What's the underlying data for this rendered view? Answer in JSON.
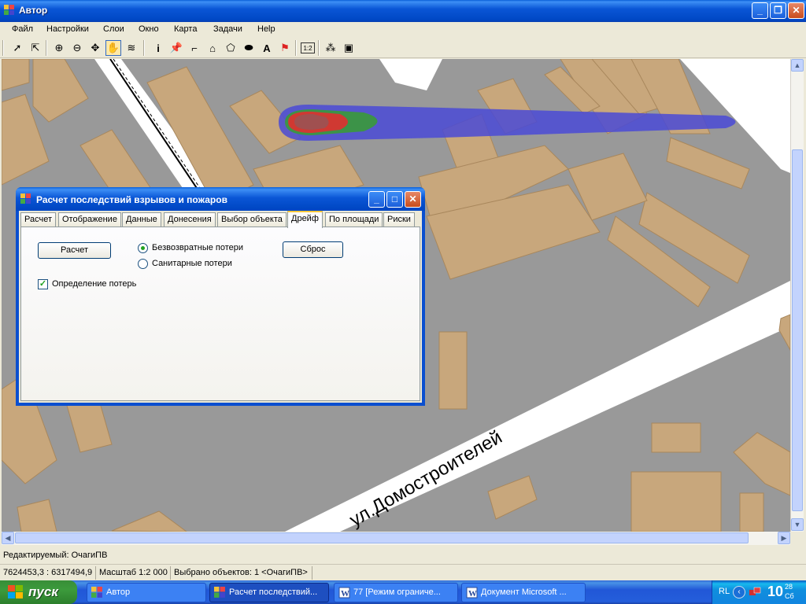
{
  "window": {
    "title": "Автор"
  },
  "menu": [
    "Файл",
    "Настройки",
    "Слои",
    "Окно",
    "Карта",
    "Задачи",
    "Help"
  ],
  "toolbar": {
    "icons": [
      "arrow-pointer-icon",
      "select-arrow-icon",
      "zoom-in-icon",
      "zoom-out-icon",
      "move-icon",
      "pan-hand-icon",
      "layers-icon",
      "info-icon",
      "pin-icon",
      "polyline-icon",
      "polygon-icon",
      "polygon-outline-icon",
      "ellipse-icon",
      "text-icon",
      "flag-icon",
      "label-icon",
      "coord-icon",
      "image-icon"
    ]
  },
  "map": {
    "street_label": "ул.Домостроителей"
  },
  "dialog": {
    "title": "Расчет последствий взрывов и пожаров",
    "tabs": [
      "Расчет",
      "Отображение",
      "Данные",
      "Донесения",
      "Выбор объекта",
      "Дрейф",
      "По площади",
      "Риски"
    ],
    "active_tab": "Дрейф",
    "calc_button": "Расчет",
    "reset_button": "Сброс",
    "radio_irrecoverable": "Безвозвратные потери",
    "radio_sanitary": "Санитарные потери",
    "checkbox_losses": "Определение потерь",
    "checkbox_checked": true,
    "radio_selected": "Безвозвратные потери"
  },
  "status": {
    "editable": "Редактируемый: ОчагиПВ",
    "coords": "7624453,3 : 6317494,9",
    "scale": "Масштаб 1:2 000",
    "selected": "Выбрано объектов: 1 <ОчагиПВ>"
  },
  "taskbar": {
    "start": "пуск",
    "tasks": [
      "Автор",
      "Расчет последствий...",
      "77 [Режим ограниче...",
      "Документ Microsoft ..."
    ],
    "lang": "RL",
    "time_hour": "10",
    "time_min": "28",
    "time_day": "Сб"
  },
  "colors": {
    "map_bg": "#999999",
    "building": "#c8a77c",
    "plume_blue": "#4a4ad6",
    "plume_green": "#3a9a3a",
    "plume_red": "#e03030"
  }
}
